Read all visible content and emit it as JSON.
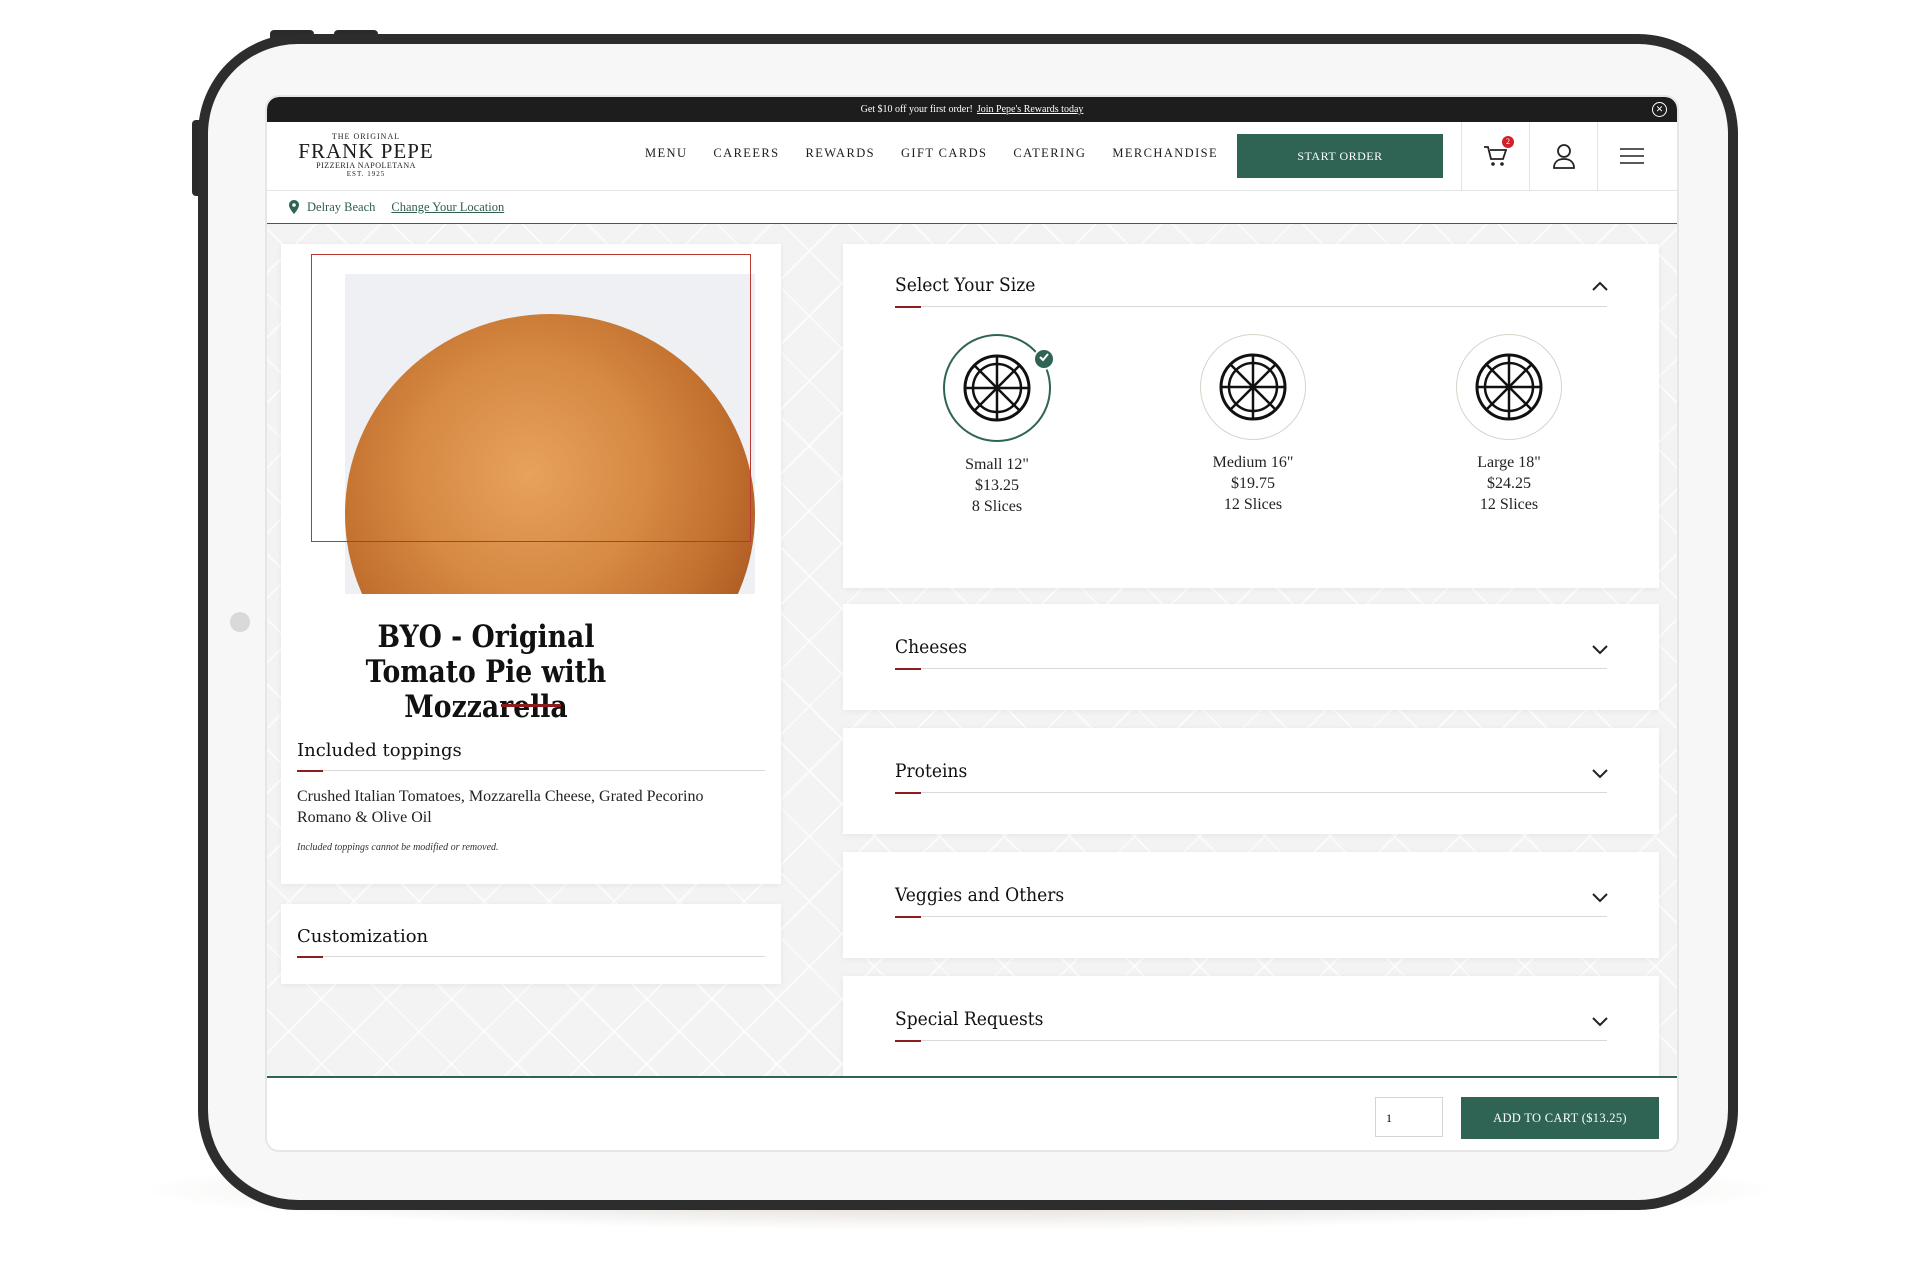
{
  "promo": {
    "text": "Get $10 off your first order!",
    "link": "Join Pepe's Rewards today"
  },
  "logo": {
    "line1": "THE ORIGINAL",
    "line2": "FRANK PEPE",
    "line3": "PIZZERIA NAPOLETANA",
    "line4": "EST. 1925"
  },
  "nav": {
    "items": [
      "MENU",
      "CAREERS",
      "REWARDS",
      "GIFT CARDS",
      "CATERING",
      "MERCHANDISE"
    ],
    "start_order": "START ORDER",
    "cart_count": "2"
  },
  "location": {
    "name": "Delray Beach",
    "change": "Change Your Location"
  },
  "product": {
    "title": "BYO - Original Tomato Pie with Mozzarella",
    "included_heading": "Included toppings",
    "included_text": "Crushed Italian Tomatoes, Mozzarella Cheese, Grated Pecorino Romano & Olive Oil",
    "note": "Included toppings cannot be modified or removed.",
    "customization_heading": "Customization"
  },
  "size_section": {
    "title": "Select Your Size",
    "options": [
      {
        "name": "Small 12\"",
        "price": "$13.25",
        "slices": "8 Slices",
        "selected": true
      },
      {
        "name": "Medium 16\"",
        "price": "$19.75",
        "slices": "12 Slices",
        "selected": false
      },
      {
        "name": "Large 18\"",
        "price": "$24.25",
        "slices": "12 Slices",
        "selected": false
      }
    ]
  },
  "accordions": [
    "Cheeses",
    "Proteins",
    "Veggies and Others",
    "Special Requests"
  ],
  "bottom": {
    "quantity": "1",
    "add_to_cart": "ADD TO CART ($13.25)"
  },
  "colors": {
    "brand_green": "#2f6354",
    "accent_red": "#8b1e1c",
    "badge_red": "#d0202a"
  }
}
